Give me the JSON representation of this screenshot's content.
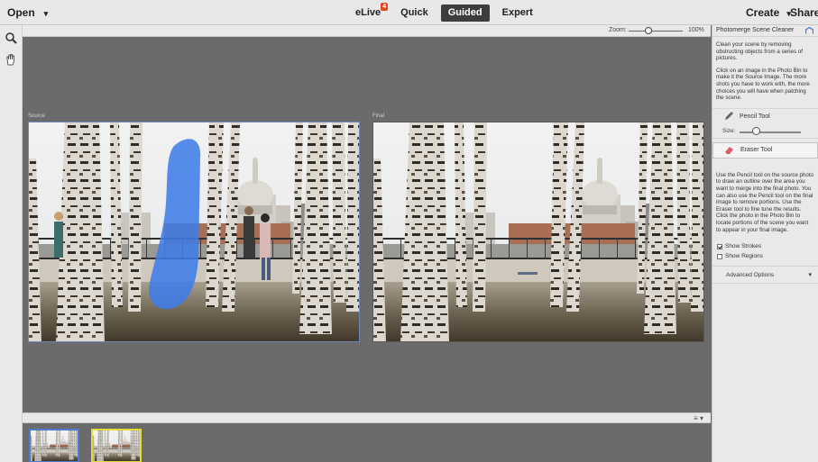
{
  "topbar": {
    "open_label": "Open",
    "modes": [
      "eLive",
      "Quick",
      "Guided",
      "Expert"
    ],
    "active_mode": "Guided",
    "elive_badge": "4",
    "create_label": "Create",
    "share_label": "Share"
  },
  "tools": [
    "zoom-icon",
    "hand-icon"
  ],
  "canvas": {
    "zoom_label": "Zoom:",
    "zoom_value": "100%",
    "source_label": "Source",
    "final_label": "Final"
  },
  "panel": {
    "title": "Photomerge Scene Cleaner",
    "desc_1": "Clean your scene by removing obstructing objects from a series of pictures.",
    "desc_2": "Click on an image in the Photo Bin to make it the Source Image. The more shots you have to work with, the more choices you will have when patching the scene.",
    "pencil_label": "Pencil Tool",
    "size_label": "Size:",
    "eraser_label": "Eraser Tool",
    "desc_3": "Use the Pencil tool on the source photo to draw an outline over the area you want to merge into the final photo. You can also use the Pencil tool on the final image to remove portions. Use the Eraser tool to fine tune the results. Click the photo in the Photo Bin to locate portions of the scene you want to appear in your final image.",
    "show_strokes_label": "Show Strokes",
    "show_strokes_checked": true,
    "show_regions_label": "Show Regions",
    "show_regions_checked": false,
    "advanced_label": "Advanced Options"
  },
  "colors": {
    "stroke_blue": "#3f7de8",
    "active_thumb_border": "#e2dc3b",
    "source_frame": "#6f88b5"
  }
}
